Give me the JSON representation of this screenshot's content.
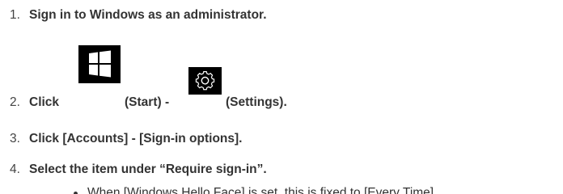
{
  "steps": [
    {
      "number": "1.",
      "text": "Sign in to Windows as an administrator."
    },
    {
      "number": "2.",
      "click_label": "Click",
      "start_label": "(Start) -",
      "settings_label": "(Settings).",
      "icons": [
        "windows-start-icon",
        "settings-gear-icon"
      ]
    },
    {
      "number": "3.",
      "text": "Click [Accounts] - [Sign-in options]."
    },
    {
      "number": "4.",
      "text": "Select the item under “Require sign-in”."
    }
  ],
  "note": "When [Windows Hello Face] is set, this is fixed to [Every Time].",
  "colors": {
    "text": "#333333",
    "icon_bg": "#000000",
    "icon_fg": "#ffffff"
  }
}
